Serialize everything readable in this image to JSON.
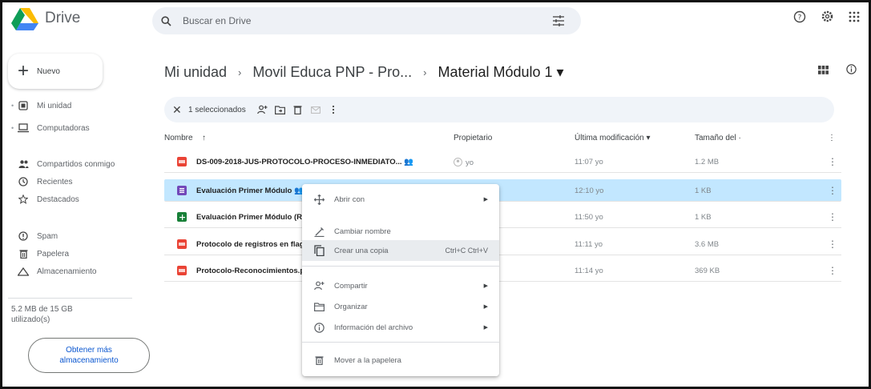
{
  "app": {
    "name": "Drive"
  },
  "search": {
    "placeholder": "Buscar en Drive"
  },
  "sidebar": {
    "new_label": "Nuevo",
    "items": [
      {
        "label": "Mi unidad",
        "icon": "drive-icon"
      },
      {
        "label": "Computadoras",
        "icon": "computer-icon"
      },
      {
        "label": "Compartidos conmigo",
        "icon": "shared-icon"
      },
      {
        "label": "Recientes",
        "icon": "clock-icon"
      },
      {
        "label": "Destacados",
        "icon": "star-icon"
      },
      {
        "label": "Spam",
        "icon": "spam-icon"
      },
      {
        "label": "Papelera",
        "icon": "trash-icon"
      },
      {
        "label": "Almacenamiento",
        "icon": "cloud-icon"
      }
    ],
    "storage_line1": "5.2 MB de 15 GB",
    "storage_line2": "utilizado(s)",
    "storage_button_line1": "Obtener más",
    "storage_button_line2": "almacenamiento"
  },
  "breadcrumb": {
    "items": [
      "Mi unidad",
      "Movil Educa PNP - Pro...",
      "Material Módulo 1 ▾"
    ],
    "separator": "›"
  },
  "selection_bar": {
    "count_label": "1 seleccionados",
    "close": "✕"
  },
  "table": {
    "headers": {
      "name": "Nombre",
      "sort_arrow": "↑",
      "owner": "Propietario",
      "modified": "Última modificación ▾",
      "size": "Tamaño del ·"
    },
    "rows": [
      {
        "name": "DS-009-2018-JUS-PROTOCOLO-PROCESO-INMEDIATO... 👥",
        "type": "pdf",
        "owner": "yo",
        "modified": "11:07 yo",
        "size": "1.2 MB"
      },
      {
        "name": "Evaluación Primer Módulo 👥",
        "type": "form",
        "owner": "",
        "modified": "12:10 yo",
        "size": "1 KB"
      },
      {
        "name": "Evaluación Primer Módulo (R",
        "type": "sheet",
        "owner": "",
        "modified": "11:50 yo",
        "size": "1 KB"
      },
      {
        "name": "Protocolo de registros en flag",
        "type": "pdf",
        "owner": "",
        "modified": "11:11 yo",
        "size": "3.6 MB"
      },
      {
        "name": "Protocolo-Reconocimientos.p",
        "type": "pdf",
        "owner": "",
        "modified": "11:14 yo",
        "size": "369 KB"
      }
    ]
  },
  "context_menu": {
    "items": [
      {
        "label": "Abrir con",
        "icon": "move-icon",
        "submenu": true
      },
      {
        "label": "Cambiar nombre",
        "icon": "pencil-icon"
      },
      {
        "label": "Crear una copia",
        "icon": "copy-icon",
        "shortcut": "Ctrl+C Ctrl+V"
      },
      {
        "label": "Compartir",
        "icon": "share-person-icon",
        "submenu": true
      },
      {
        "label": "Organizar",
        "icon": "folder-icon",
        "submenu": true
      },
      {
        "label": "Información del archivo",
        "icon": "info-icon",
        "submenu": true
      },
      {
        "label": "Mover a la papelera",
        "icon": "trash-icon"
      }
    ],
    "submenu_arrow": "▶"
  },
  "colors": {
    "selected_row": "#c2e7ff",
    "pdf": "#ea4335",
    "form": "#7248b9",
    "sheet": "#188038",
    "accent": "#0b57d0"
  }
}
